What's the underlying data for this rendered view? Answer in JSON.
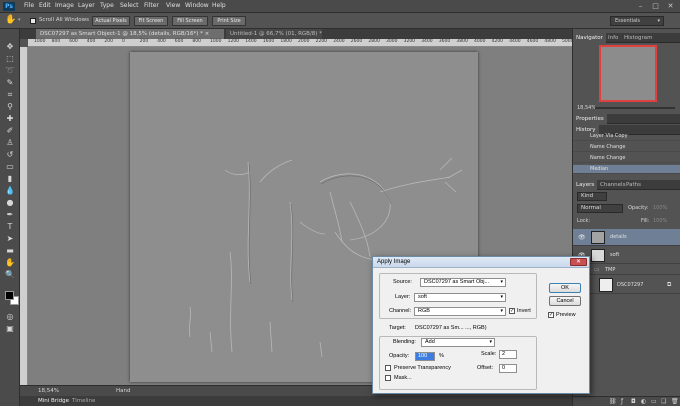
{
  "app": {
    "logo": "Ps"
  },
  "menu": [
    "File",
    "Edit",
    "Image",
    "Layer",
    "Type",
    "Select",
    "Filter",
    "View",
    "Window",
    "Help"
  ],
  "window_controls": {
    "minimize": "–",
    "maximize": "□",
    "close": "✕"
  },
  "options_bar": {
    "scroll_all_windows": "Scroll All Windows",
    "actual_pixels": "Actual Pixels",
    "fit_screen": "Fit Screen",
    "fill_screen": "Fill Screen",
    "print_size": "Print Size",
    "workspace": "Essentials"
  },
  "tabs": [
    {
      "label": "DSC07297 as Smart Object-1 @ 18,5% (details, RGB/16*) *",
      "close": "×"
    },
    {
      "label": "Untitled-1 @ 66,7% (01, RGB/8) *",
      "close": "×"
    }
  ],
  "ruler_labels": [
    "1000",
    "800",
    "600",
    "400",
    "200",
    "0",
    "200",
    "400",
    "600",
    "800",
    "1000",
    "1200",
    "1400",
    "1600",
    "1800",
    "2000",
    "2200",
    "2400",
    "2600",
    "2800",
    "3000",
    "3200",
    "3400",
    "3600",
    "3800",
    "4000",
    "4200",
    "4400",
    "4600",
    "4800",
    "5000"
  ],
  "status": {
    "zoom": "18,54%",
    "tool": "Hand"
  },
  "bottom_tabs": [
    "Mini Bridge",
    "Timeline"
  ],
  "navigator": {
    "tabs": [
      "Navigator",
      "Info",
      "Histogram"
    ],
    "zoom": "18,54%",
    "accent": "#e04040"
  },
  "properties": {
    "title": "Properties"
  },
  "history": {
    "title": "History",
    "items": [
      "Layer Via Copy",
      "Name Change",
      "Name Change",
      "Median"
    ]
  },
  "layers": {
    "tabs": [
      "Layers",
      "Channels",
      "Paths"
    ],
    "kind": "Kind",
    "blend_mode": "Normal",
    "opacity_label": "Opacity:",
    "opacity_value": "100%",
    "lock_label": "Lock:",
    "fill_label": "Fill:",
    "fill_value": "100%",
    "items": [
      {
        "name": "details",
        "selected": true
      },
      {
        "name": "soft",
        "selected": false
      },
      {
        "name": "TMP",
        "selected": false,
        "group": true
      },
      {
        "name": "DSC07297",
        "selected": false
      }
    ]
  },
  "dialog": {
    "title": "Apply Image",
    "source_label": "Source:",
    "source_value": "DSC07297 as Smart Obj...",
    "layer_label": "Layer:",
    "layer_value": "soft",
    "channel_label": "Channel:",
    "channel_value": "RGB",
    "invert_label": "Invert",
    "invert_checked": true,
    "target_label": "Target:",
    "target_value": "DSC07297 as Sm... ..., RGB)",
    "blending_label": "Blending:",
    "blending_value": "Add",
    "opacity_label": "Opacity:",
    "opacity_value": "100",
    "opacity_unit": "%",
    "scale_label": "Scale:",
    "scale_value": "2",
    "offset_label": "Offset:",
    "offset_value": "0",
    "preserve_label": "Preserve Transparency",
    "mask_label": "Mask...",
    "ok_label": "OK",
    "cancel_label": "Cancel",
    "preview_label": "Preview",
    "preview_checked": true
  }
}
